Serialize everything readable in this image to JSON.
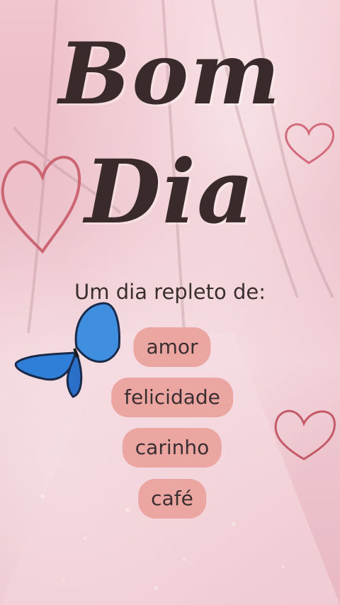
{
  "title_line1": "Bom",
  "title_line2": "Dia",
  "subtitle": "Um dia repleto de:",
  "items": [
    "amor",
    "felicidade",
    "carinho",
    "café"
  ],
  "colors": {
    "pill": "#eba6a2",
    "text": "#3b2e30",
    "butterfly": "#3f8ee0"
  },
  "icons": [
    "butterfly-icon",
    "heart-icon"
  ]
}
